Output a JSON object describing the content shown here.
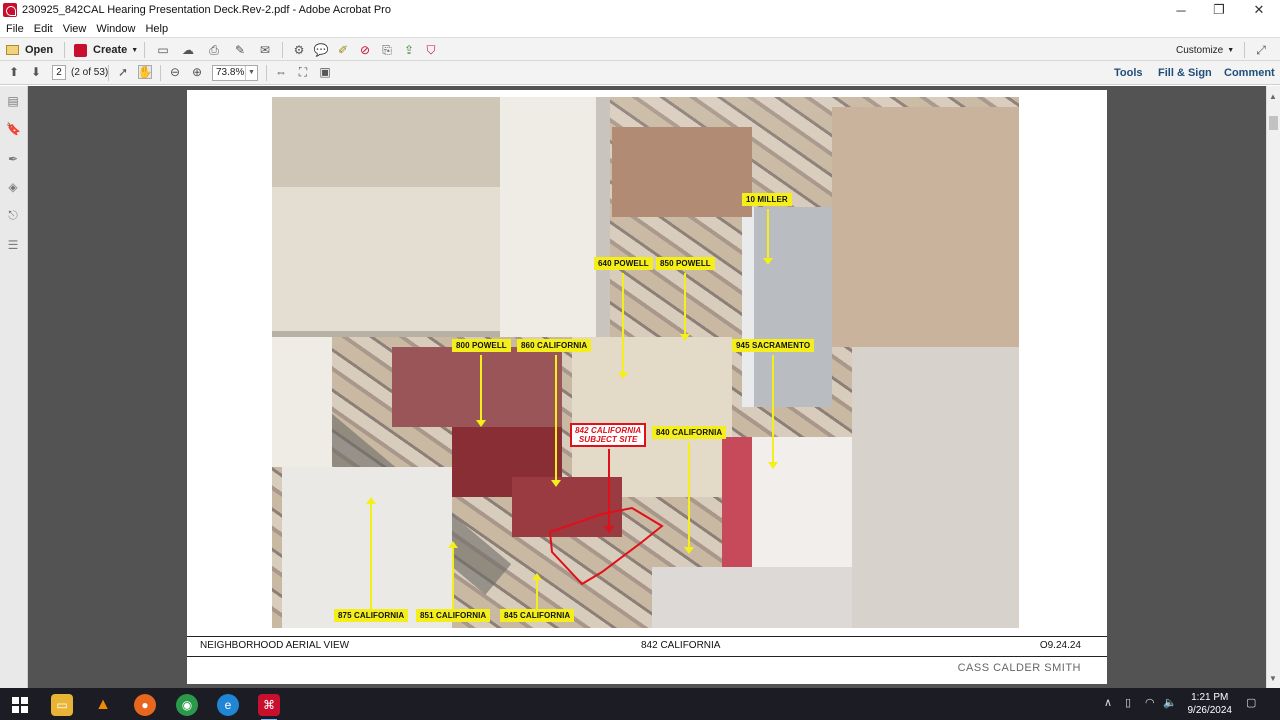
{
  "window": {
    "title": "230925_842CAL Hearing Presentation Deck.Rev-2.pdf - Adobe Acrobat Pro",
    "minimize": "─",
    "restore": "❐",
    "close": "✕"
  },
  "menu": [
    "File",
    "Edit",
    "View",
    "Window",
    "Help"
  ],
  "toolbar": {
    "open_label": "Open",
    "create_label": "Create",
    "customize_label": "Customize"
  },
  "nav": {
    "page_number": "2",
    "page_count": "(2 of 53)",
    "zoom": "73.8%",
    "tools_label": "Tools",
    "fill_sign_label": "Fill & Sign",
    "comment_label": "Comment"
  },
  "slide": {
    "callouts": {
      "miller": "10 MILLER",
      "powell640": "640 POWELL",
      "powell850": "850 POWELL",
      "powell800": "800 POWELL",
      "cal860": "860 CALIFORNIA",
      "sac945": "945 SACRAMENTO",
      "subject_line1": "842 CALIFORNIA",
      "subject_line2": "SUBJECT SITE",
      "cal840": "840 CALIFORNIA",
      "cal875": "875 CALIFORNIA",
      "cal851": "851 CALIFORNIA",
      "cal845": "845 CALIFORNIA"
    },
    "footer_left": "NEIGHBORHOOD AERIAL VIEW",
    "footer_center": "842 CALIFORNIA",
    "footer_right": "O9.24.24",
    "brand": "CASS CALDER SMITH"
  },
  "taskbar": {
    "time": "1:21 PM",
    "date": "9/26/2024"
  },
  "colors": {
    "callout_yellow": "#f4ef1a",
    "subject_red": "#e0101a",
    "doc_background": "#535353"
  }
}
